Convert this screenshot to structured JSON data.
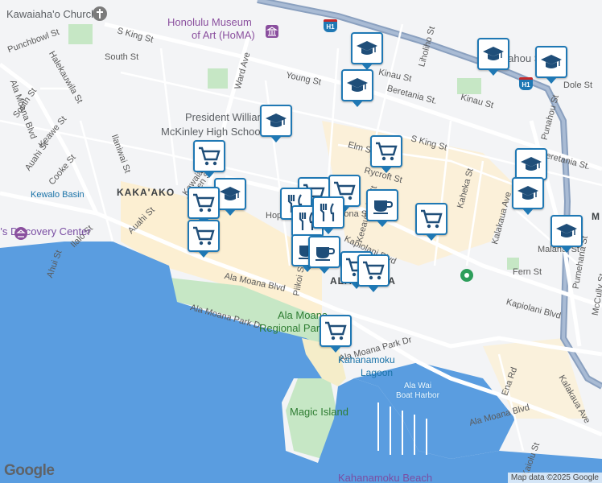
{
  "colors": {
    "ocean": "#5a9de0",
    "land": "#f3f4f6",
    "park": "#c6e7c5",
    "highway": "#8aa0bf",
    "commercial": "#fcefd2",
    "marker_border": "#1f78b4"
  },
  "streets": [
    "Punchbowl St",
    "South St",
    "Halekauwila St",
    "South St",
    "Keawe St",
    "Auahi St",
    "Cooke St",
    "Ala Moana Blvd",
    "Ilaniwai St",
    "Kawaiahao St",
    "Queen St",
    "Auahi St",
    "Ilalo St",
    "Ahui St",
    "S King St",
    "Ward Ave",
    "Young St",
    "Kinau St",
    "Beretania St.",
    "Kinau St",
    "Liholiho St",
    "Elm St",
    "S King St",
    "Rycroft St",
    "Keeaumoku St",
    "Kaheka St",
    "S Beretania St.",
    "Kalakaua Ave",
    "Punahou St",
    "Dole St",
    "Kapiolani Blvd",
    "Kapiolani Blvd",
    "Ala Moana Blvd",
    "Ala Moana Park Dr",
    "Ala Moana Park Dr",
    "Piikoi St",
    "Hopaka St",
    "Kona St",
    "Malanai St",
    "Fern St",
    "Pumehana St",
    "McCully St",
    "Ena Rd",
    "Kalakaua Ave",
    "Ala Moana Blvd",
    "Kaiolu St"
  ],
  "pois": {
    "church": "Kawaiaha'o Church",
    "museum_line1": "Honolulu Museum",
    "museum_line2": "of Art (HoMA)",
    "school_line1": "President William",
    "school_line2": "McKinley High School",
    "school_far": "Punahou School",
    "kewalo": "Kewalo Basin",
    "kakaako": "KAKA'AKO",
    "ala_moana_area": "ALA MOANA",
    "park_line1": "Ala Moana",
    "park_line2": "Regional Park",
    "magic_island": "Magic Island",
    "lagoon_line1": "Kahanamoku",
    "lagoon_line2": "Lagoon",
    "harbor_line1": "Ala Wai",
    "harbor_line2": "Boat Harbor",
    "beach": "Kahanamoku Beach",
    "children_museum": "Children's Discovery Center",
    "moiliili_m": "M"
  },
  "highway_shield": "H1",
  "markers": [
    {
      "type": "school-icon"
    },
    {
      "type": "school-icon"
    },
    {
      "type": "school-icon"
    },
    {
      "type": "school-icon"
    },
    {
      "type": "school-icon"
    },
    {
      "type": "school-icon"
    },
    {
      "type": "school-icon"
    },
    {
      "type": "school-icon"
    },
    {
      "type": "school-icon"
    },
    {
      "type": "shopping-cart-icon"
    },
    {
      "type": "shopping-cart-icon"
    },
    {
      "type": "shopping-cart-icon"
    },
    {
      "type": "shopping-cart-icon"
    },
    {
      "type": "shopping-cart-icon"
    },
    {
      "type": "shopping-cart-icon"
    },
    {
      "type": "shopping-cart-icon"
    },
    {
      "type": "shopping-cart-icon"
    },
    {
      "type": "shopping-cart-icon"
    },
    {
      "type": "shopping-cart-icon"
    },
    {
      "type": "restaurant-icon"
    },
    {
      "type": "restaurant-icon"
    },
    {
      "type": "restaurant-icon"
    },
    {
      "type": "coffee-icon"
    },
    {
      "type": "coffee-icon"
    },
    {
      "type": "coffee-icon"
    }
  ],
  "attribution": {
    "logo": "Google",
    "copyright": "Map data ©2025 Google"
  }
}
